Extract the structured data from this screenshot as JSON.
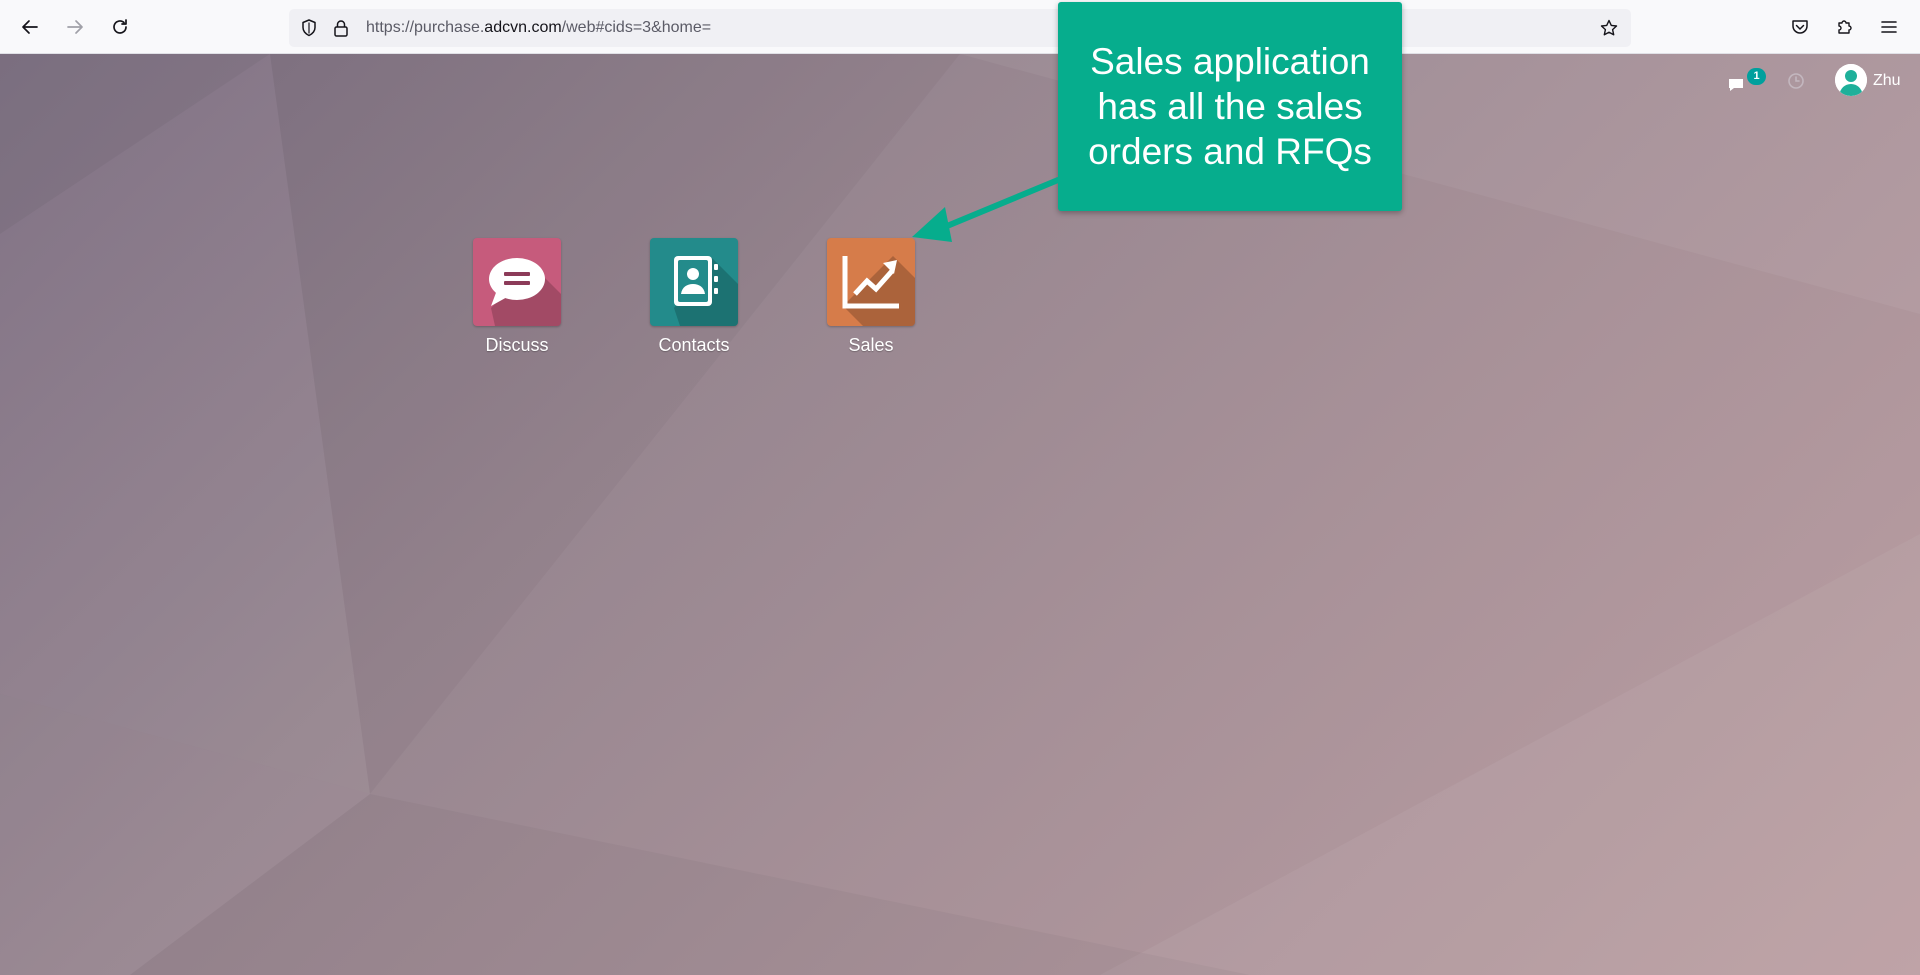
{
  "browser": {
    "url_prefix": "https://purchase.",
    "url_domain": "adcvn.com",
    "url_suffix": "/web#cids=3&home="
  },
  "topbar": {
    "chat_count": "1",
    "user_name": "Zhu"
  },
  "apps": [
    {
      "label": "Discuss",
      "color": "#c65b7c"
    },
    {
      "label": "Contacts",
      "color": "#238b8b"
    },
    {
      "label": "Sales",
      "color": "#d67c4a"
    }
  ],
  "callout": {
    "text": "Sales application has all the sales orders and RFQs",
    "color": "#06ad8d"
  }
}
